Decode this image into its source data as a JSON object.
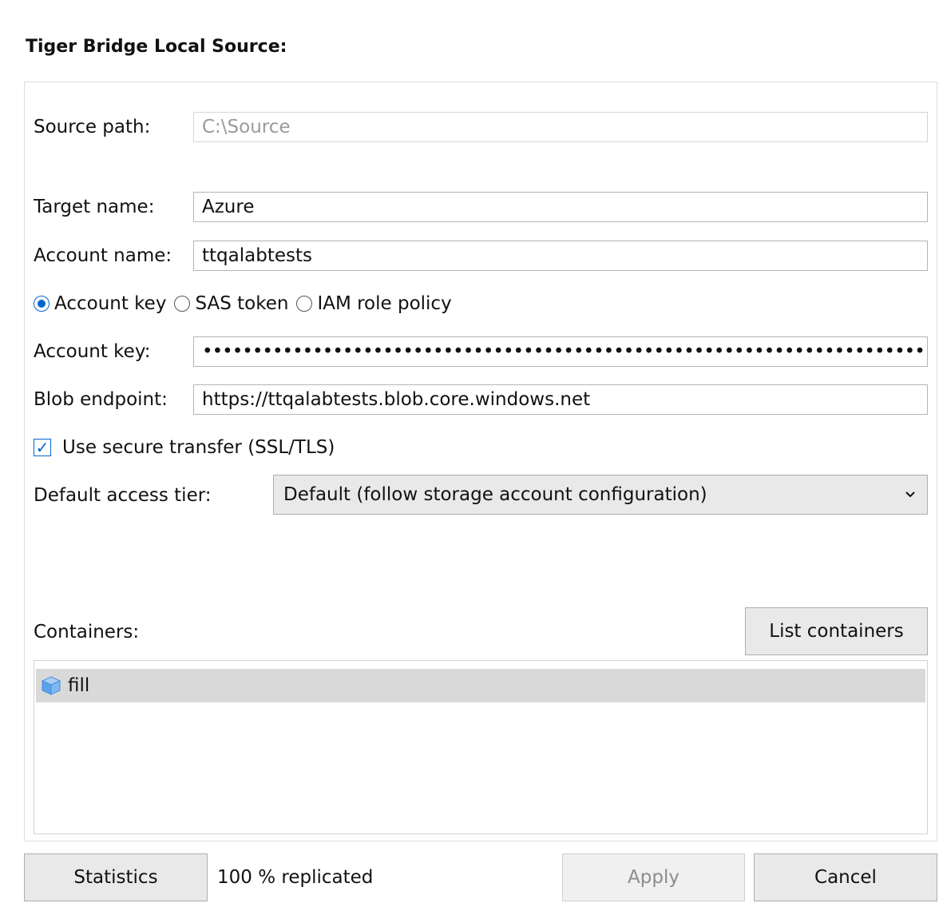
{
  "header": {
    "title": "Tiger Bridge Local Source:"
  },
  "form": {
    "source_path_label": "Source path:",
    "source_path_value": "C:\\Source",
    "target_name_label": "Target name:",
    "target_name_value": "Azure",
    "account_name_label": "Account name:",
    "account_name_value": "ttqalabtests",
    "auth_options": [
      {
        "label": "Account key",
        "selected": true
      },
      {
        "label": "SAS token",
        "selected": false
      },
      {
        "label": "IAM role policy",
        "selected": false
      }
    ],
    "account_key_label": "Account key:",
    "account_key_value": "••••••••••••••••••••••••••••••••••••••••••••••••••••••••••••••••••••••••",
    "blob_endpoint_label": "Blob endpoint:",
    "blob_endpoint_value": "https://ttqalabtests.blob.core.windows.net",
    "secure_transfer_label": "Use secure transfer (SSL/TLS)",
    "secure_transfer_checked": true,
    "access_tier_label": "Default access tier:",
    "access_tier_value": "Default (follow storage account configuration)"
  },
  "containers": {
    "label": "Containers:",
    "list_button": "List containers",
    "items": [
      {
        "name": "fill",
        "icon": "container-cube-icon"
      }
    ]
  },
  "footer": {
    "statistics_button": "Statistics",
    "replication_status": "100 % replicated",
    "apply_button": "Apply",
    "cancel_button": "Cancel"
  },
  "colors": {
    "accent": "#0066cc",
    "selected_row": "#d9d9d9",
    "button_bg": "#e9e9e9"
  }
}
